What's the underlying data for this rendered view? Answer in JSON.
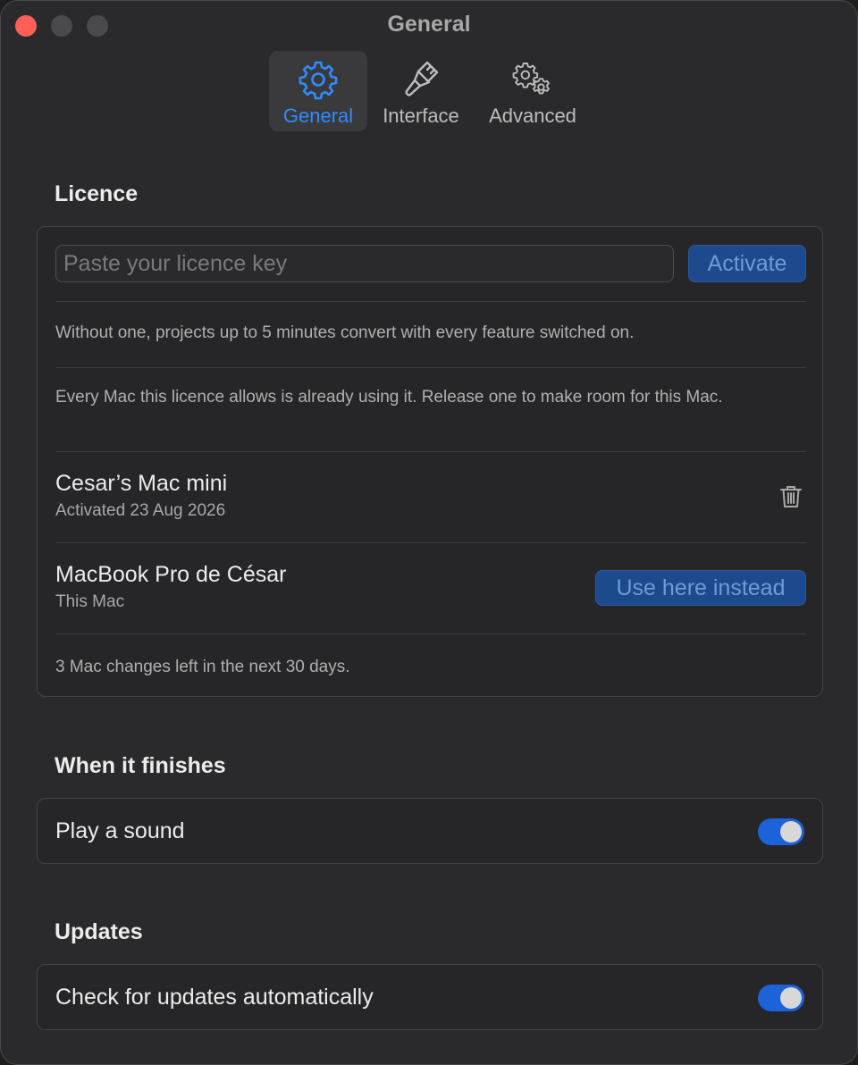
{
  "window": {
    "title": "General"
  },
  "tabs": [
    {
      "label": "General",
      "icon": "gear-icon",
      "selected": true
    },
    {
      "label": "Interface",
      "icon": "paintbrush-icon",
      "selected": false
    },
    {
      "label": "Advanced",
      "icon": "gears-icon",
      "selected": false
    }
  ],
  "licence": {
    "section_title": "Licence",
    "input_placeholder": "Paste your licence key",
    "activate_label": "Activate",
    "trial_note": "Without one, projects up to 5 minutes convert with every feature switched on.",
    "limit_note": "Every Mac this licence allows is already using it. Release one to make room for this Mac.",
    "macs": [
      {
        "name": "Cesar’s Mac mini",
        "status": "Activated 23 Aug 2026",
        "action": "trash-icon"
      },
      {
        "name": "MacBook Pro de César",
        "status": "This Mac",
        "action_label": "Use here instead"
      }
    ],
    "changes_left": "3 Mac changes left in the next 30 days."
  },
  "finish": {
    "section_title": "When it finishes",
    "play_sound_label": "Play a sound",
    "play_sound_on": true
  },
  "updates": {
    "section_title": "Updates",
    "auto_check_label": "Check for updates automatically",
    "auto_check_on": true
  },
  "colors": {
    "accent": "#2f8cff",
    "toggle_on": "#1c62d8",
    "close_button": "#ff5f57",
    "window_bg": "#2a2a2c"
  }
}
